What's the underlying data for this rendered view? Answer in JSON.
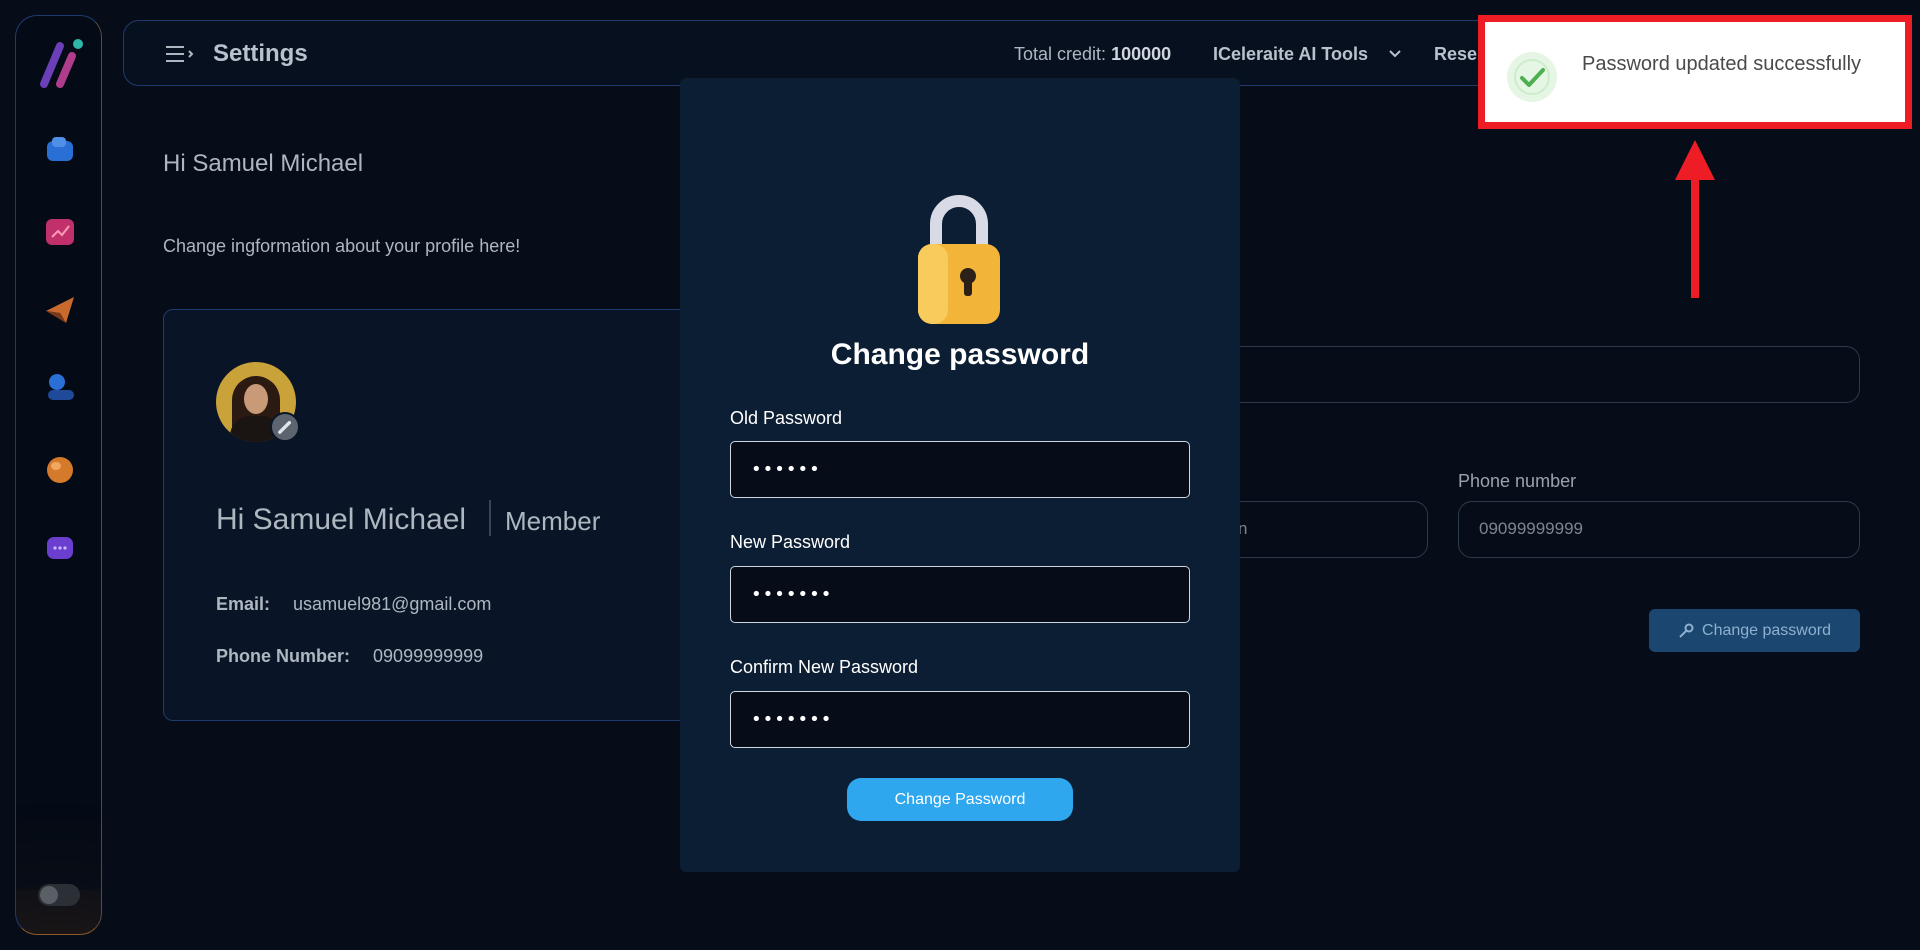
{
  "header": {
    "title": "Settings",
    "credit_label": "Total credit:",
    "credit_value": "100000",
    "tools_label": "ICeleraite AI Tools",
    "reset_label": "Rese"
  },
  "content": {
    "greeting": "Hi Samuel Michael",
    "subtext": "Change ingformation about your profile here!"
  },
  "profile_card": {
    "name": "Hi Samuel Michael",
    "role": "Member",
    "email_label": "Email:",
    "email_value": "usamuel981@gmail.com",
    "phone_label": "Phone Number:",
    "phone_value": "09099999999"
  },
  "right_form": {
    "partial_value": "n",
    "phone_label": "Phone number",
    "phone_value": "09099999999",
    "change_password_label": "Change password"
  },
  "modal": {
    "title": "Change password",
    "old_label": "Old Password",
    "old_value": "••••••",
    "new_label": "New Password",
    "new_value": "•••••••",
    "confirm_label": "Confirm New Password",
    "confirm_value": "•••••••",
    "submit_label": "Change Password"
  },
  "toast": {
    "message": "Password updated successfully",
    "status_color": "#4caf50",
    "icon": "check-icon"
  },
  "colors": {
    "accent": "#2ea7ef",
    "highlight": "#ee1c24",
    "background": "#060d18"
  }
}
